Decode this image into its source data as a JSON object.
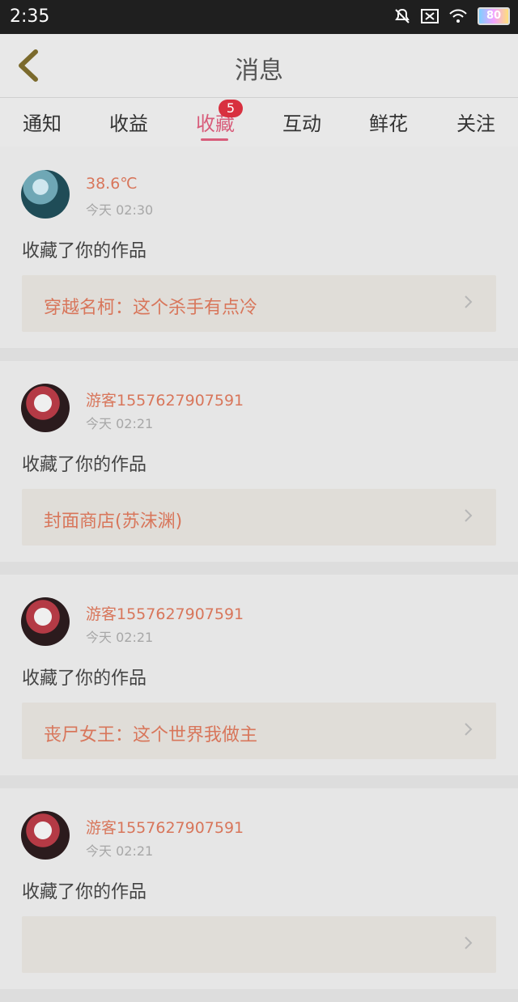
{
  "status_bar": {
    "time": "2:35",
    "battery": "80"
  },
  "header": {
    "title": "消息"
  },
  "tabs": [
    {
      "label": "通知"
    },
    {
      "label": "收益"
    },
    {
      "label": "收藏",
      "badge": "5",
      "active": true
    },
    {
      "label": "互动"
    },
    {
      "label": "鲜花"
    },
    {
      "label": "关注"
    }
  ],
  "feed": [
    {
      "user": "38.6℃",
      "time": "今天 02:30",
      "action": "收藏了你的作品",
      "work": "穿越名柯：这个杀手有点冷",
      "avatar": "photo"
    },
    {
      "user": "游客1557627907591",
      "time": "今天 02:21",
      "action": "收藏了你的作品",
      "work": "封面商店(苏沫渊)",
      "avatar": "anime"
    },
    {
      "user": "游客1557627907591",
      "time": "今天 02:21",
      "action": "收藏了你的作品",
      "work": "丧尸女王：这个世界我做主",
      "avatar": "anime"
    },
    {
      "user": "游客1557627907591",
      "time": "今天 02:21",
      "action": "收藏了你的作品",
      "work": "",
      "avatar": "anime"
    }
  ],
  "colors": {
    "accent": "#d85c7a",
    "link": "#d8765b",
    "badge": "#d8303f"
  },
  "icons": [
    "back-chevron-icon",
    "mute-bell-icon",
    "signal-off-icon",
    "wifi-icon",
    "battery-icon",
    "chevron-right-icon"
  ]
}
